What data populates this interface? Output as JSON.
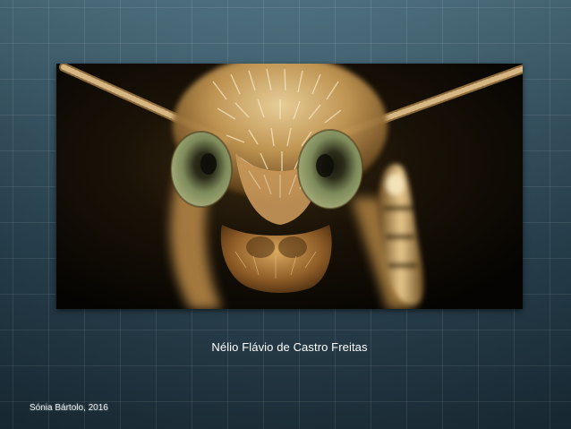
{
  "slide": {
    "caption": "Nélio Flávio de Castro Freitas",
    "credit": "Sónia Bártolo, 2016"
  },
  "colors": {
    "background_top": "#4e7484",
    "background_bottom": "#1b2f3b",
    "grid_line": "#ffffff",
    "text": "#ffffff"
  }
}
